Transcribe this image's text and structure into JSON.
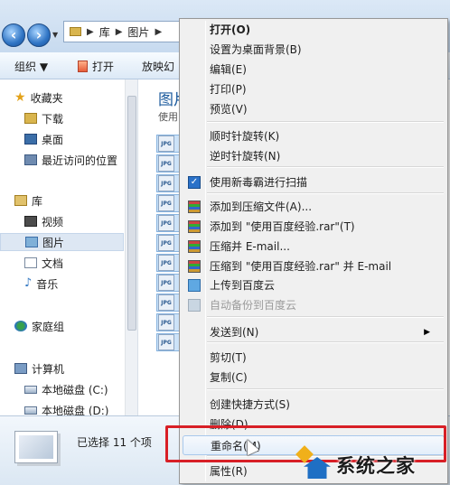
{
  "address_bar": {
    "breadcrumbs": [
      "库",
      "图片"
    ]
  },
  "toolbar": {
    "organize": "组织 ▼",
    "open": "打开",
    "slideshow": "放映幻",
    "overflow": "»"
  },
  "sidebar": {
    "items": [
      {
        "label": "收藏夹",
        "icon": "star-icon"
      },
      {
        "label": "下载",
        "icon": "folder-icon"
      },
      {
        "label": "桌面",
        "icon": "desktop-icon"
      },
      {
        "label": "最近访问的位置",
        "icon": "recent-places-icon"
      },
      {
        "label": "库",
        "icon": "library-icon"
      },
      {
        "label": "视频",
        "icon": "video-icon"
      },
      {
        "label": "图片",
        "icon": "pictures-icon",
        "selected": true
      },
      {
        "label": "文档",
        "icon": "documents-icon"
      },
      {
        "label": "音乐",
        "icon": "music-icon"
      },
      {
        "label": "家庭组",
        "icon": "homegroup-icon"
      },
      {
        "label": "计算机",
        "icon": "computer-icon"
      },
      {
        "label": "本地磁盘 (C:)",
        "icon": "drive-icon"
      },
      {
        "label": "本地磁盘 (D:)",
        "icon": "drive-icon"
      }
    ]
  },
  "content": {
    "title": "图片",
    "subtitle": "使用",
    "file_icon_label": "JPG"
  },
  "statusbar": {
    "text": "已选择 11 个项"
  },
  "context_menu": {
    "items": [
      {
        "label": "打开(O)",
        "bold": true
      },
      {
        "label": "设置为桌面背景(B)"
      },
      {
        "label": "编辑(E)"
      },
      {
        "label": "打印(P)"
      },
      {
        "label": "预览(V)"
      },
      {
        "label": "顺时针旋转(K)"
      },
      {
        "label": "逆时针旋转(N)"
      },
      {
        "label": "使用新毒霸进行扫描",
        "icon": "antivirus-scan-icon"
      },
      {
        "label": "添加到压缩文件(A)...",
        "icon": "winrar-icon"
      },
      {
        "label": "添加到 \"使用百度经验.rar\"(T)",
        "icon": "winrar-icon"
      },
      {
        "label": "压缩并 E-mail...",
        "icon": "winrar-icon"
      },
      {
        "label": "压缩到 \"使用百度经验.rar\" 并 E-mail",
        "icon": "winrar-icon"
      },
      {
        "label": "上传到百度云",
        "icon": "baidu-cloud-icon"
      },
      {
        "label": "自动备份到百度云",
        "icon": "baidu-cloud-icon",
        "disabled": true
      },
      {
        "label": "发送到(N)",
        "submenu": true
      },
      {
        "label": "剪切(T)"
      },
      {
        "label": "复制(C)"
      },
      {
        "label": "创建快捷方式(S)"
      },
      {
        "label": "删除(D)"
      },
      {
        "label": "重命名(M)",
        "hover": true
      },
      {
        "label": "属性(R)"
      }
    ],
    "submenu_arrow": "▶"
  },
  "watermark": {
    "text": "系统之家"
  },
  "colors": {
    "highlight_border": "#d81f26",
    "menu_background": "#f0f0f0",
    "title_blue": "#1e5c9e"
  }
}
